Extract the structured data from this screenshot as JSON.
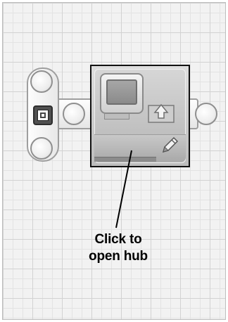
{
  "workspace": {
    "program": {
      "start_block": {
        "icon": "start-icon"
      },
      "display_block": {
        "icons": [
          "monitor-icon",
          "upload-icon",
          "pencil-icon"
        ],
        "hub_state": "collapsed"
      }
    }
  },
  "annotation": {
    "line1": "Click to",
    "line2": "open hub"
  },
  "colors": {
    "grid_background": "#f2f2f2",
    "grid_line": "#d2d2d2",
    "block_body": "#bdbdbd",
    "block_outline": "#111111",
    "annotation_text": "#000000"
  }
}
